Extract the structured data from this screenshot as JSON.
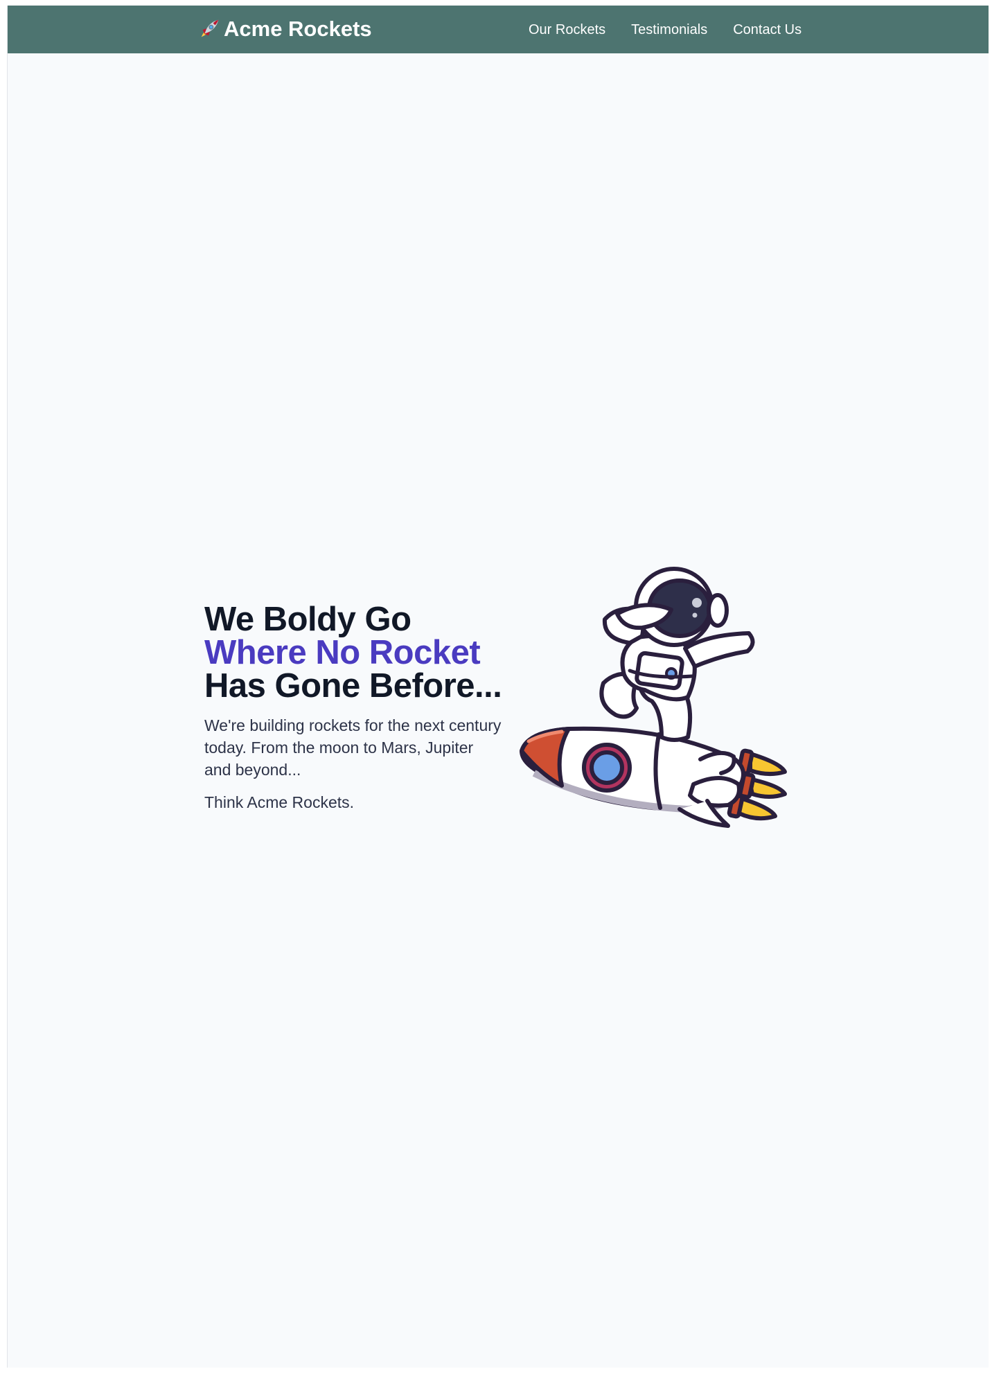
{
  "navbar": {
    "logo_emoji": "rocket-icon",
    "logo_text": "Acme Rockets",
    "links": [
      {
        "label": "Our Rockets"
      },
      {
        "label": "Testimonials"
      },
      {
        "label": "Contact Us"
      }
    ],
    "background": "#4d7470"
  },
  "hero": {
    "title_line1": "We Boldy Go",
    "title_line2": "Where No Rocket",
    "title_line3": "Has Gone Before...",
    "description": "We're building rockets for the next century today. From the moon to Mars, Jupiter and beyond...",
    "tagline": "Think Acme Rockets.",
    "accent_color": "#4a3bc0",
    "image": "astronaut-riding-rocket-illustration"
  }
}
